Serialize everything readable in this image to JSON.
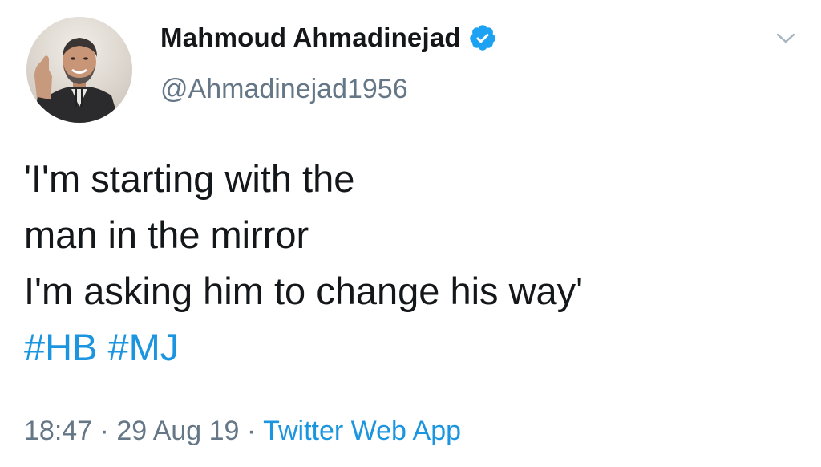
{
  "author": {
    "display_name": "Mahmoud Ahmadinejad",
    "handle": "@Ahmadinejad1956",
    "verified": true,
    "avatar_icon": "profile-photo-avatar"
  },
  "tweet": {
    "lines": [
      "'I'm starting with the",
      "man in the mirror",
      "I'm asking him to change his way'"
    ],
    "hashtags": [
      "#HB",
      "#MJ"
    ]
  },
  "meta": {
    "time": "18:47",
    "separator": " · ",
    "date": "29 Aug 19",
    "source": "Twitter Web App"
  },
  "icons": {
    "verified": "verified-badge-icon",
    "menu": "chevron-down-icon"
  },
  "colors": {
    "link": "#1b95e0",
    "secondary_text": "#657786",
    "primary_text": "#14171a",
    "verified_badge": "#1da1f2"
  }
}
